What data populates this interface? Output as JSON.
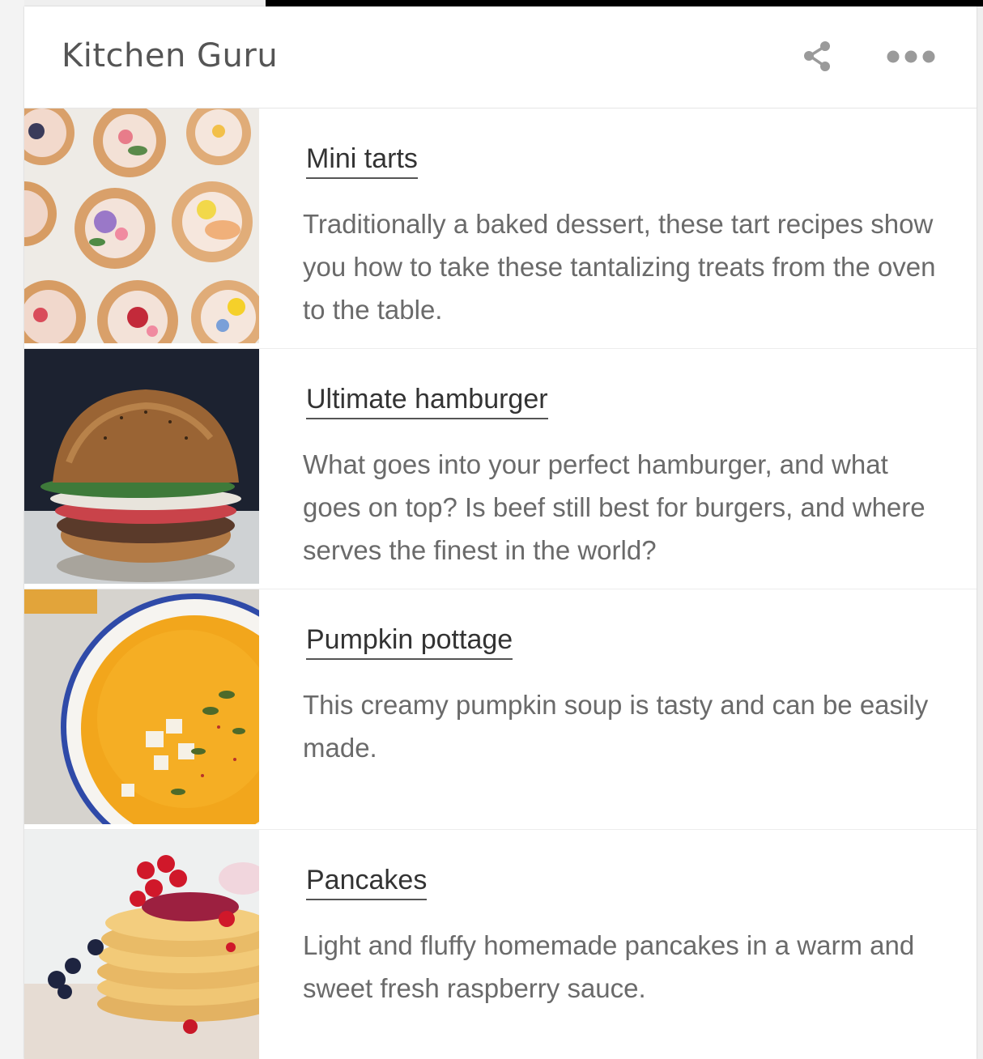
{
  "app": {
    "title": "Kitchen Guru"
  },
  "header": {
    "share_icon": "share-icon",
    "more_icon": "more-horizontal-icon"
  },
  "recipes": [
    {
      "title": "Mini tarts",
      "description": "Traditionally a baked dessert, these tart recipes show you how to take these tantalizing treats from the oven to the table."
    },
    {
      "title": "Ultimate hamburger",
      "description": "What goes into your perfect hamburger, and what goes on top? Is beef still best for burgers, and where serves the finest in the world?"
    },
    {
      "title": "Pumpkin pottage",
      "description": "This creamy pumpkin soup is tasty and can be easily made."
    },
    {
      "title": "Pancakes",
      "description": "Light and fluffy homemade pancakes in a warm and sweet fresh raspberry sauce."
    }
  ],
  "colors": {
    "title_text": "#333333",
    "description_text": "#6a6a6a",
    "header_text": "#555555",
    "icon": "#9a9a9a"
  }
}
